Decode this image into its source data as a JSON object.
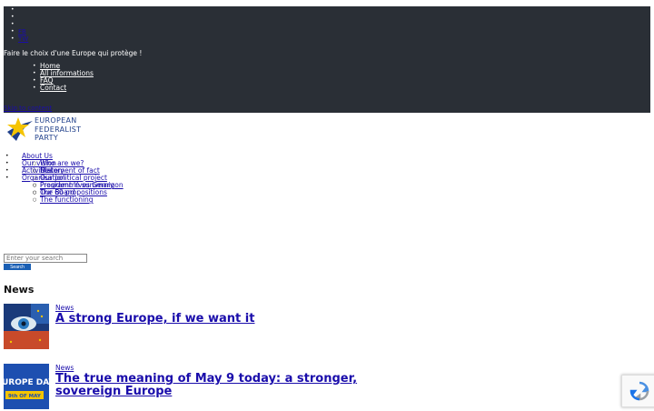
{
  "topbar": {
    "social": [
      "",
      "",
      "",
      "FB",
      "TW"
    ],
    "tagline": "Faire le choix d'une Europe qui protège !",
    "nav": [
      "Home",
      "All informations",
      "FAQ",
      "Contact"
    ]
  },
  "skip_link": "Skip to content",
  "logo": {
    "lines": [
      "EUROPEAN",
      "FEDERALIST",
      "PARTY"
    ]
  },
  "mainnav": {
    "about": "About Us",
    "about_items": [
      "Who are we?",
      "History"
    ],
    "vision": "Our vision",
    "vision_items": [
      "Statement of fact",
      "Our political project",
      "Programme summary",
      "Our 60 propositions"
    ],
    "activities": "Activities",
    "organisation": "Organisation",
    "organisation_items": [
      "President Yves Gernigon",
      "The Board",
      "The functioning"
    ]
  },
  "search": {
    "placeholder": "Enter your search",
    "button": "Search"
  },
  "section_title": "News",
  "posts": [
    {
      "category": "News",
      "title": "A strong Europe, if we want it"
    },
    {
      "category": "News",
      "title": "The true meaning of May 9 today: a stronger, sovereign Europe",
      "thumb_lines": [
        "UROPE DAY",
        "9th OF MAY"
      ]
    }
  ],
  "colors": {
    "topbar": "#2a2f36",
    "link": "#1a0dab",
    "brand_blue": "#1f3f8a",
    "star_yellow": "#f5c400"
  }
}
